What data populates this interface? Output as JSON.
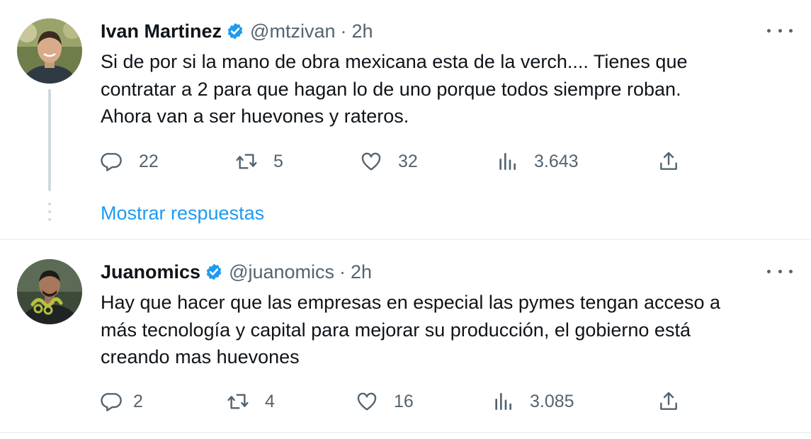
{
  "tweets": [
    {
      "name": "Ivan Martinez",
      "handle": "@mtzivan",
      "separator": "·",
      "time": "2h",
      "verified": true,
      "avatar_icon": "profile-photo",
      "text_lines": [
        "Si de por si la mano de obra mexicana esta de la verch.... Tienes que",
        "contratar a 2 para que hagan lo de uno porque todos siempre roban.",
        "Ahora van a ser huevones y rateros."
      ],
      "stats": {
        "replies": "22",
        "retweets": "5",
        "likes": "32",
        "views": "3.643"
      },
      "show_replies_label": "Mostrar respuestas"
    },
    {
      "name": "Juanomics",
      "handle": "@juanomics",
      "separator": "·",
      "time": "2h",
      "verified": true,
      "avatar_icon": "profile-photo",
      "text_lines": [
        "Hay que hacer que las empresas en especial las pymes tengan acceso a",
        "más tecnología y capital para mejorar su producción, el gobierno está",
        "creando mas huevones"
      ],
      "stats": {
        "replies": "2",
        "retweets": "4",
        "likes": "16",
        "views": "3.085"
      }
    }
  ],
  "icons": {
    "reply": "reply-icon",
    "retweet": "retweet-icon",
    "like": "like-icon",
    "views": "views-icon",
    "share": "share-icon",
    "more": "more-icon",
    "verified": "verified-badge-icon"
  },
  "colors": {
    "text": "#0f1419",
    "secondary": "#536471",
    "link": "#1d9bf0",
    "verified": "#1d9bf0",
    "divider": "#eff3f4",
    "thread_line": "#cfd9de"
  }
}
